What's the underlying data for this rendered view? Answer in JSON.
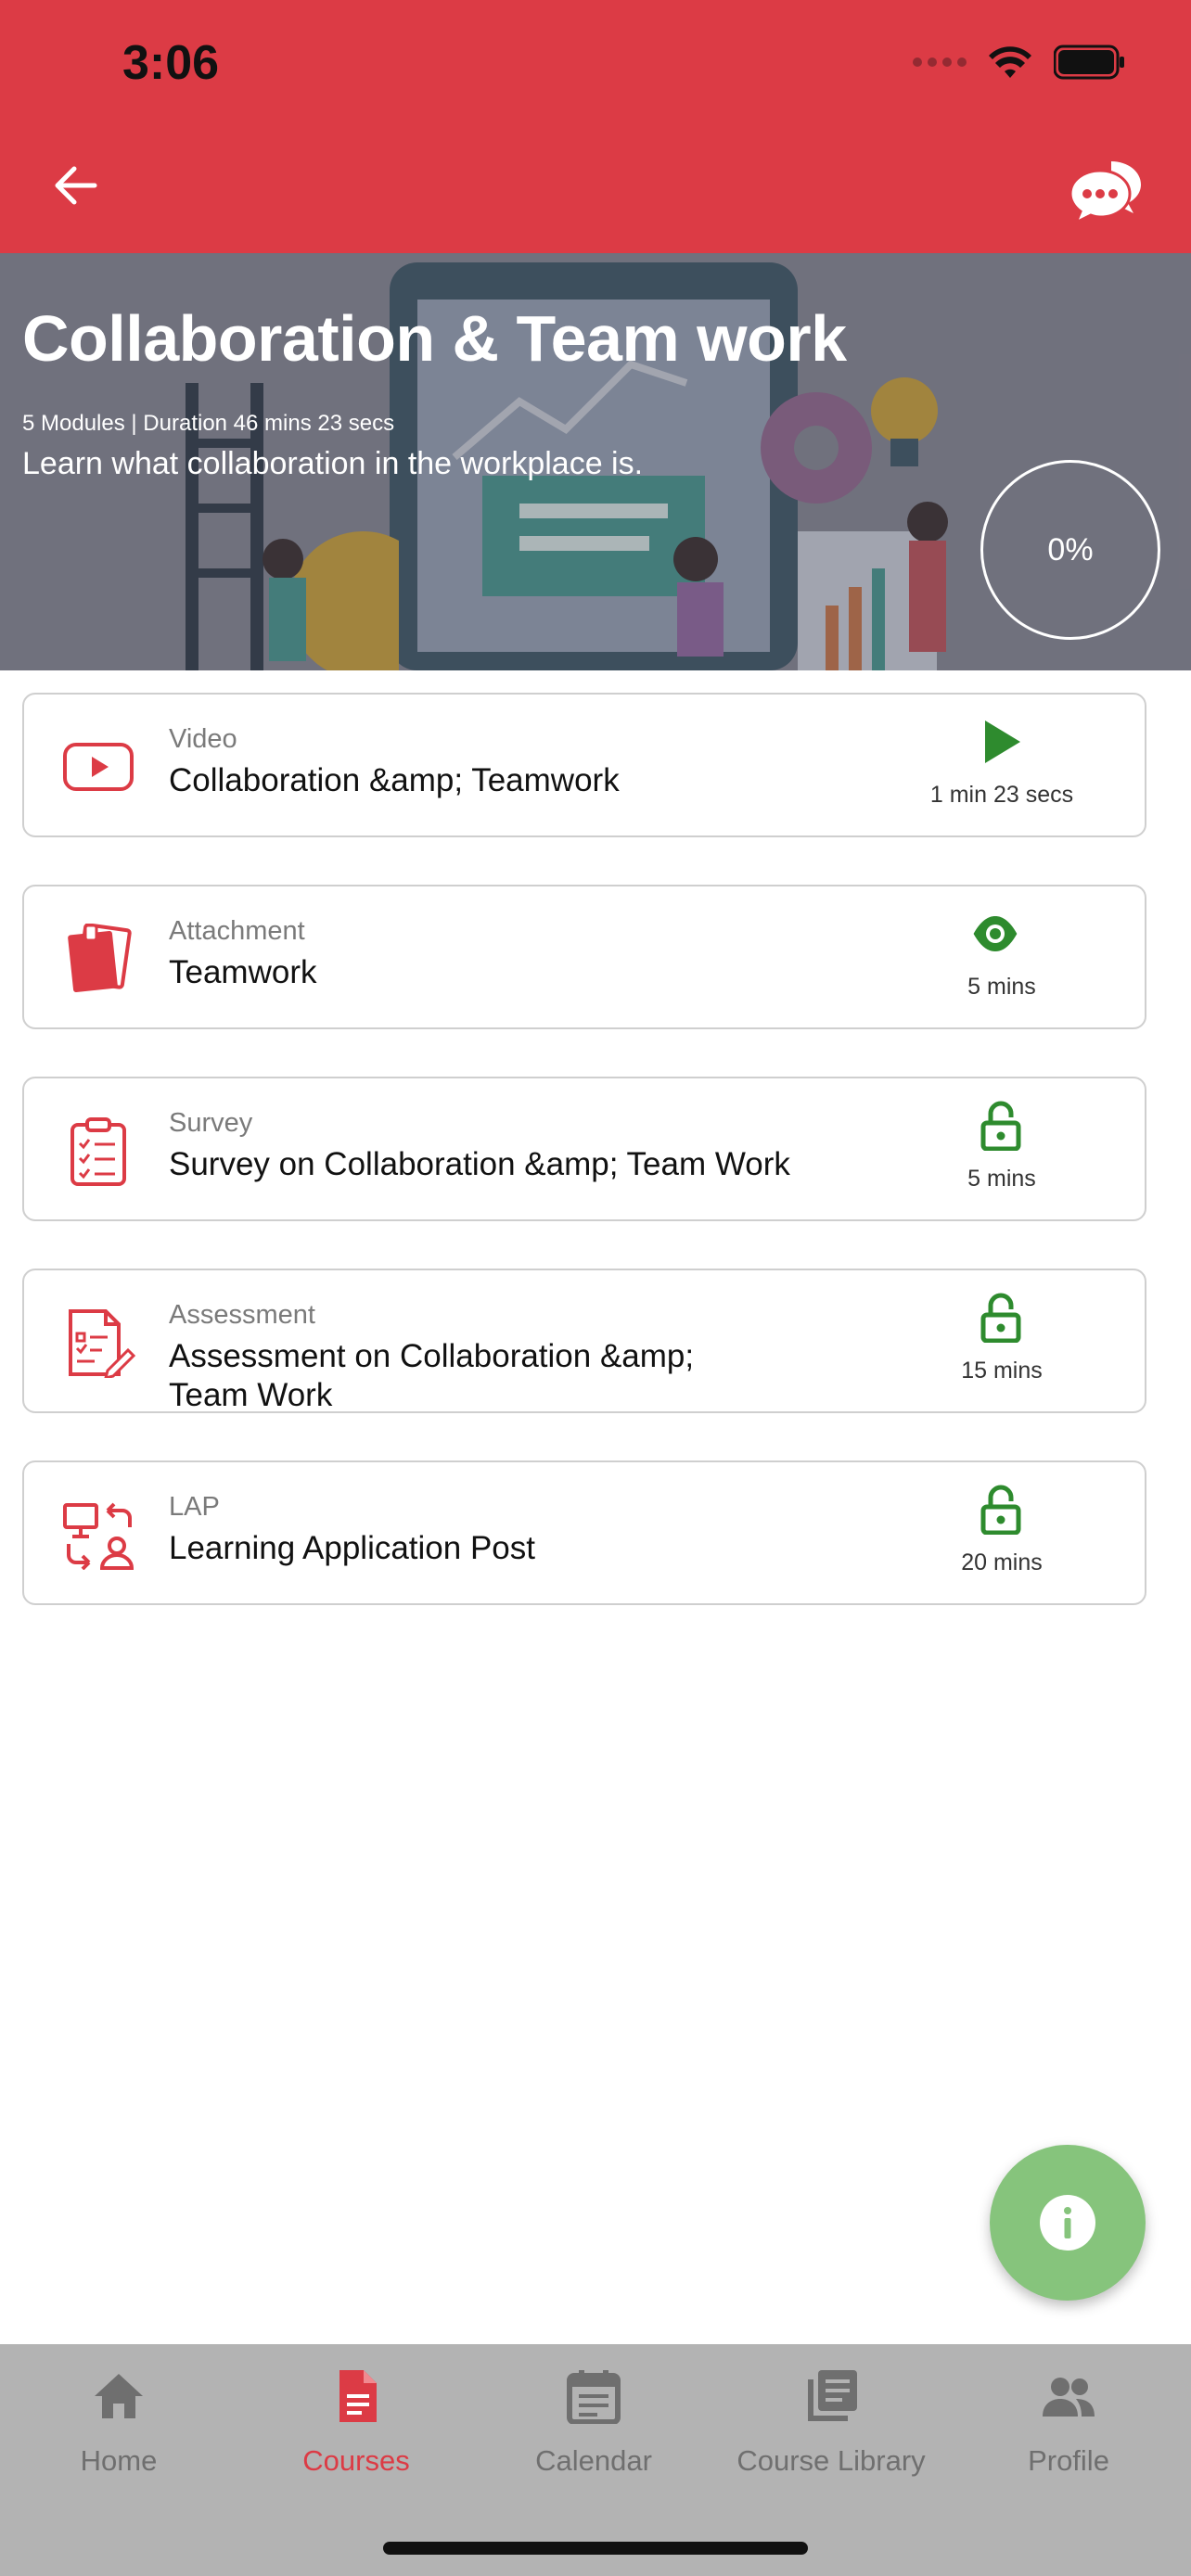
{
  "status_bar": {
    "time": "3:06"
  },
  "header": {
    "back_icon": "arrow-left-icon",
    "chat_icon": "chat-bubbles-icon"
  },
  "course": {
    "title": "Collaboration & Team work",
    "meta": "5 Modules | Duration 46 mins 23 secs",
    "description": "Learn what collaboration in the workplace is.",
    "progress": "0%"
  },
  "modules": [
    {
      "type": "Video",
      "name": "Collaboration &amp; Teamwork",
      "duration": "1 min 23 secs",
      "type_icon": "youtube-icon",
      "status_icon": "play-icon"
    },
    {
      "type": "Attachment",
      "name": "Teamwork",
      "duration": "5 mins",
      "type_icon": "documents-icon",
      "status_icon": "eye-icon"
    },
    {
      "type": "Survey",
      "name": "Survey on Collaboration &amp; Team Work",
      "duration": "5 mins",
      "type_icon": "clipboard-checklist-icon",
      "status_icon": "unlock-icon"
    },
    {
      "type": "Assessment",
      "name": "Assessment on Collaboration &amp; Team Work",
      "duration": "15 mins",
      "type_icon": "assessment-form-icon",
      "status_icon": "unlock-icon"
    },
    {
      "type": "LAP",
      "name": "Learning Application Post",
      "duration": "20 mins",
      "type_icon": "exchange-icon",
      "status_icon": "unlock-icon"
    }
  ],
  "fab": {
    "icon": "info-icon"
  },
  "nav": [
    {
      "label": "Home",
      "icon": "home-icon"
    },
    {
      "label": "Courses",
      "icon": "document-icon",
      "active": true
    },
    {
      "label": "Calendar",
      "icon": "calendar-icon"
    },
    {
      "label": "Course Library",
      "icon": "library-icon"
    },
    {
      "label": "Profile",
      "icon": "people-icon"
    }
  ],
  "colors": {
    "brand": "#dc3b45",
    "success": "#2e8b2e",
    "fab": "#86c47c",
    "nav_bg": "#b3b3b3"
  }
}
